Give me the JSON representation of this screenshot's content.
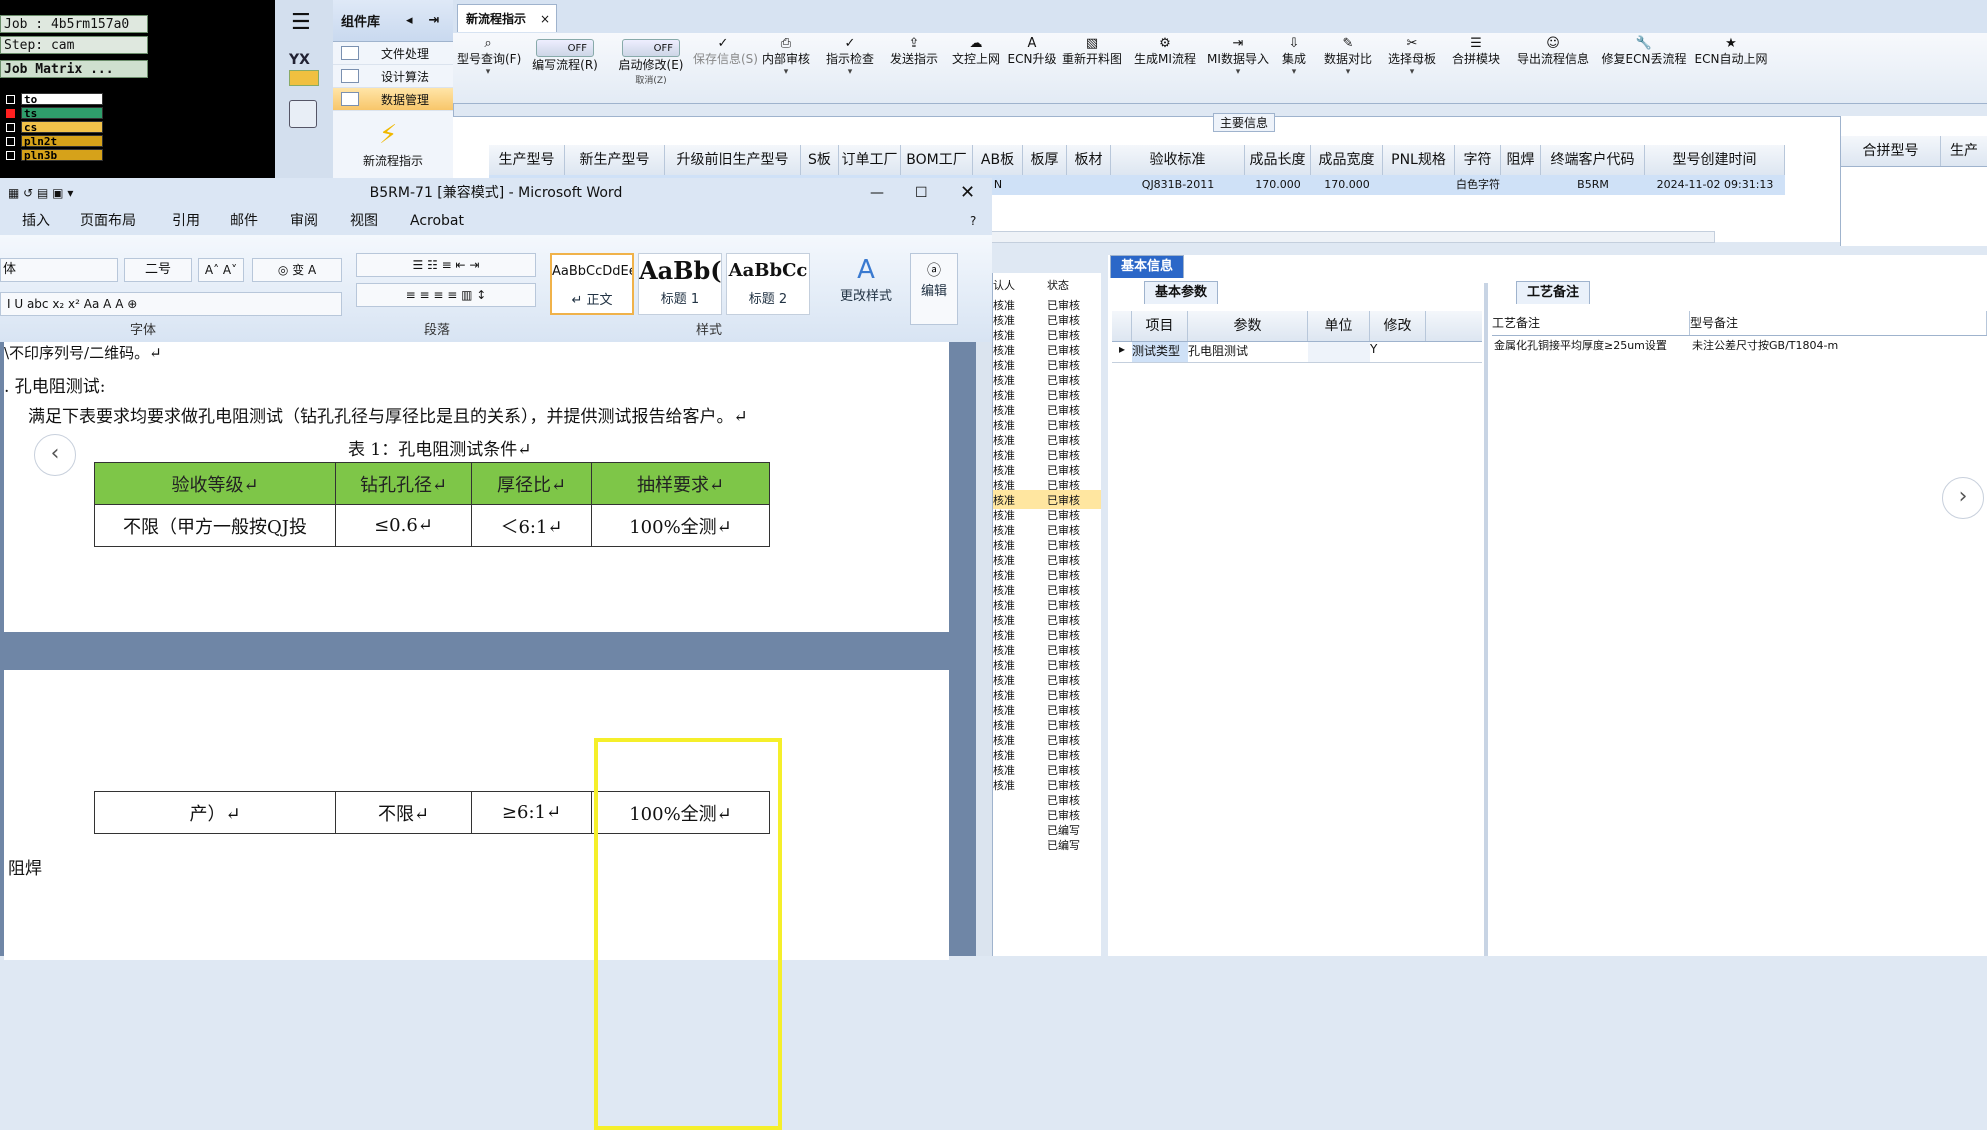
{
  "cam": {
    "job": "Job : 4b5rm157a0",
    "step": "Step: cam",
    "matrix": "Job Matrix ...",
    "layers": [
      {
        "name": "to",
        "color": "#ffffff",
        "mark": "#ffffff"
      },
      {
        "name": "ts",
        "color": "#2f9e6b",
        "mark": "#ff2020"
      },
      {
        "name": "cs",
        "color": "#f2c24a",
        "mark": "#000000"
      },
      {
        "name": "pln2t",
        "color": "#d6a21a",
        "mark": "#000000"
      },
      {
        "name": "pln3b",
        "color": "#d6a21a",
        "mark": "#000000"
      }
    ]
  },
  "rail": {
    "logo": "YX"
  },
  "group": {
    "title": "组件库",
    "items": [
      "文件处理",
      "设计算法",
      "数据管理"
    ],
    "action": "新流程指示"
  },
  "app": {
    "tab": "新流程指示",
    "toolbar": [
      {
        "label": "型号查询(F)",
        "glyph": "⌕",
        "arrow": "▾"
      },
      {
        "label": "编写流程(R)",
        "glyph": "OFF",
        "arrow": ""
      },
      {
        "label": "启动修改(E)",
        "glyph": "OFF",
        "arrow": "取消(Z)"
      },
      {
        "label": "保存信息(S)",
        "glyph": "✓",
        "arrow": ""
      },
      {
        "label": "内部审核",
        "glyph": "⎙",
        "arrow": "▾"
      },
      {
        "label": "指示检查",
        "glyph": "✓",
        "arrow": "▾"
      },
      {
        "label": "发送指示",
        "glyph": "⇪",
        "arrow": ""
      },
      {
        "label": "文控上网",
        "glyph": "☁",
        "arrow": ""
      },
      {
        "label": "ECN升级",
        "glyph": "A",
        "arrow": ""
      },
      {
        "label": "重新开料图",
        "glyph": "▧",
        "arrow": ""
      },
      {
        "label": "生成MI流程",
        "glyph": "⚙",
        "arrow": ""
      },
      {
        "label": "MI数据导入",
        "glyph": "⇥",
        "arrow": "▾"
      },
      {
        "label": "集成",
        "glyph": "⇩",
        "arrow": "▾"
      },
      {
        "label": "数据对比",
        "glyph": "✎",
        "arrow": "▾"
      },
      {
        "label": "选择母板",
        "glyph": "✂",
        "arrow": "▾"
      },
      {
        "label": "合拼模块",
        "glyph": "☰",
        "arrow": ""
      },
      {
        "label": "导出流程信息",
        "glyph": "☺",
        "arrow": ""
      },
      {
        "label": "修复ECN丢流程",
        "glyph": "🔧",
        "arrow": ""
      },
      {
        "label": "ECN自动上网",
        "glyph": "★",
        "arrow": ""
      }
    ],
    "main_info_title": "主要信息",
    "columns": [
      "生产型号",
      "新生产型号",
      "升级前旧生产型号",
      "S板",
      "订单工厂",
      "BOM工厂",
      "AB板",
      "板厚",
      "板材",
      "验收标准",
      "成品长度",
      "成品宽度",
      "PNL规格",
      "字符",
      "阻焊",
      "终端客户代码",
      "型号创建时间"
    ],
    "row": {
      "ab": "N",
      "standard": "QJ831B-2011",
      "length": "170.000",
      "width": "170.000",
      "char": "白色字符",
      "customer": "B5RM",
      "created": "2024-11-02 09:31:13"
    },
    "merge_columns": [
      "合拼型号",
      "生产"
    ]
  },
  "word": {
    "title": "B5RM-71 [兼容模式] - Microsoft Word",
    "menus": [
      "插入",
      "页面布局",
      "引用",
      "邮件",
      "审阅",
      "视图",
      "Acrobat"
    ],
    "font_name": "体",
    "font_size": "二号",
    "group_labels": {
      "font": "字体",
      "para": "段落",
      "styles": "样式"
    },
    "styles": [
      {
        "sample": "AaBbCcDdEe",
        "name": "↵ 正文"
      },
      {
        "sample": "AaBb(",
        "name": "标题 1"
      },
      {
        "sample": "AaBbCc",
        "name": "标题 2"
      }
    ],
    "change_styles": "更改样式",
    "edit": "编辑",
    "doc": {
      "line0": "\\不印序列号/二维码。↵",
      "line1": ". 孔电阻测试:",
      "line2": "满足下表要求均要求做孔电阻测试（钻孔孔径与厚径比是且的关系），并提供测试报告给客户。↵",
      "caption": "表 1：孔电阻测试条件↵",
      "headers": [
        "验收等级↵",
        "钻孔孔径↵",
        "厚径比↵",
        "抽样要求↵"
      ],
      "row1": [
        "不限（甲方一般按QJ投",
        "≤0.6↵",
        "＜6:1↵",
        "100%全测↵"
      ],
      "row2": [
        "产）↵",
        "不限↵",
        "≥6:1↵",
        "100%全测↵"
      ],
      "tail": "阻焊"
    }
  },
  "status": {
    "header_left": "认人",
    "header": "状态",
    "values": [
      "已审核",
      "已审核",
      "已审核",
      "已审核",
      "已审核",
      "已审核",
      "已审核",
      "已审核",
      "已审核",
      "已审核",
      "已审核",
      "已审核",
      "已审核",
      "已审核",
      "已审核",
      "已审核",
      "已审核",
      "已审核",
      "已审核",
      "已审核",
      "已审核",
      "已审核",
      "已审核",
      "已审核",
      "已审核",
      "已审核",
      "已审核",
      "已审核",
      "已审核",
      "已审核",
      "已审核",
      "已审核",
      "已审核",
      "已审核",
      "已审核",
      "已编写",
      "已编写"
    ],
    "left_fragments": [
      "核准",
      "核准",
      "核准",
      "核准",
      "核准",
      "核准",
      "核准",
      "核准",
      "核准",
      "核准",
      "核准",
      "核准",
      "核准",
      "核准",
      "核准",
      "核准",
      "核准",
      "核准",
      "核准",
      "核准",
      "核准",
      "核准",
      "核准",
      "核准",
      "核准",
      "核准",
      "核准",
      "核准",
      "核准",
      "核准",
      "核准",
      "核准",
      "核准"
    ]
  },
  "basic": {
    "title": "基本信息",
    "tab": "基本参数",
    "columns": [
      "项目",
      "参数",
      "单位",
      "修改"
    ],
    "row": [
      "测试类型",
      "孔电阻测试",
      "",
      "Y"
    ],
    "craft_tab": "工艺备注",
    "craft_columns": [
      "工艺备注",
      "型号备注"
    ],
    "craft_note": "金属化孔铜接平均厚度≥25um设置",
    "model_note": "未注公差尺寸按GB/T1804-m"
  }
}
